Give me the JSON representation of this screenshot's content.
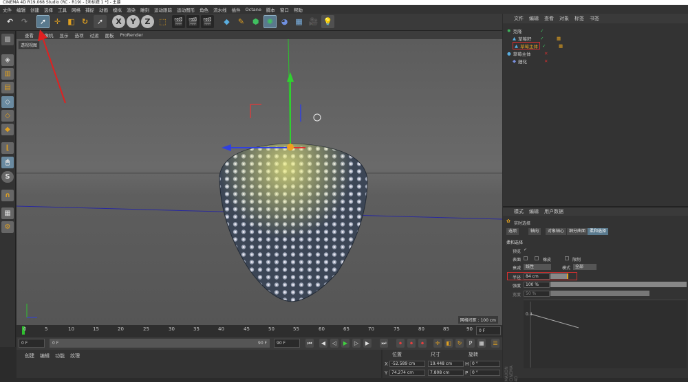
{
  "app": {
    "title": "CINEMA 4D R19.068 Studio (RC - R19) - [未标题 1 *] - 主要"
  },
  "menu": [
    "文件",
    "编辑",
    "创建",
    "选择",
    "工具",
    "网格",
    "捕捉",
    "动画",
    "模拟",
    "渲染",
    "雕刻",
    "运动跟踪",
    "运动图形",
    "角色",
    "流水线",
    "插件",
    "Octane",
    "脚本",
    "窗口",
    "帮助"
  ],
  "toolbar": {
    "axis_x": "X",
    "axis_y": "Y",
    "axis_z": "Z"
  },
  "viewport": {
    "menu": [
      "查看",
      "摄像机",
      "显示",
      "选项",
      "过滤",
      "面板",
      "ProRender"
    ],
    "label": "透视视图",
    "grid_spacing": "网格间距 : 100 cm"
  },
  "timeline": {
    "ticks": [
      "0",
      "5",
      "10",
      "15",
      "20",
      "25",
      "30",
      "35",
      "40",
      "45",
      "50",
      "55",
      "60",
      "65",
      "70",
      "75",
      "80",
      "85",
      "90"
    ],
    "current_frame": "0 F"
  },
  "transport": {
    "start": "0 F",
    "range_start": "0 F",
    "range_end": "90 F",
    "end": "90 F"
  },
  "bottom_tabs": [
    "创建",
    "编辑",
    "功能",
    "纹理"
  ],
  "coordinates": {
    "headers": [
      "位置",
      "尺寸",
      "旋转"
    ],
    "rows": [
      {
        "axis": "X",
        "pos": "-52.589 cm",
        "size": "19.448 cm",
        "rot_axis": "H",
        "rot": "0 °"
      },
      {
        "axis": "Y",
        "pos": "74.274 cm",
        "size": "7.808 cm",
        "rot_axis": "P",
        "rot": "0 °"
      }
    ]
  },
  "objects": {
    "menu": [
      "文件",
      "编辑",
      "查看",
      "对象",
      "标签",
      "书签"
    ],
    "items": [
      {
        "name": "克隆",
        "indent": 0
      },
      {
        "name": "草莓籽",
        "indent": 1
      },
      {
        "name": "草莓主体",
        "indent": 1
      },
      {
        "name": "草莓主体",
        "indent": 0
      },
      {
        "name": "细化",
        "indent": 1
      }
    ]
  },
  "attributes": {
    "menu": [
      "模式",
      "编辑",
      "用户数据"
    ],
    "title": "实时选择",
    "tabs": [
      "选项",
      "轴向",
      "对象轴心",
      "细分曲面",
      "柔和选择"
    ],
    "section": "柔和选择",
    "preview_label": "预览",
    "surface_label": "表面",
    "rubber_label": "橡皮",
    "limit_label": "限制",
    "falloff_label": "衰减",
    "falloff_value": "线性",
    "mode_label": "模式",
    "mode_value": "全部",
    "radius_label": "半径",
    "radius_value": "84 cm",
    "strength_label": "强度",
    "strength_value": "100 %",
    "width_label": "宽度",
    "width_value": "50 %",
    "curve_value": "0.8",
    "watermark": "MAXON CINEMA 4D"
  },
  "colors": {
    "accent": "#5a7a8e",
    "highlight": "#e08a00",
    "error": "#d03030"
  }
}
